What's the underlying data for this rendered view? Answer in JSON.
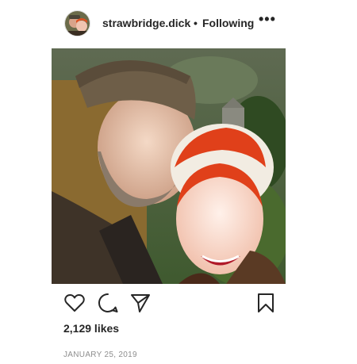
{
  "post": {
    "username": "strawbridge.dick",
    "separator": "•",
    "follow_status": "Following",
    "more_label": "•••",
    "likes": "2,129 likes",
    "date": "JANUARY 25, 2019"
  },
  "icons": {
    "like": "heart-icon",
    "comment": "comment-icon",
    "share": "send-icon",
    "save": "bookmark-icon",
    "more": "more-options-icon"
  },
  "colors": {
    "text": "#262626",
    "secondary": "#8e8e8e",
    "background": "#ffffff"
  }
}
